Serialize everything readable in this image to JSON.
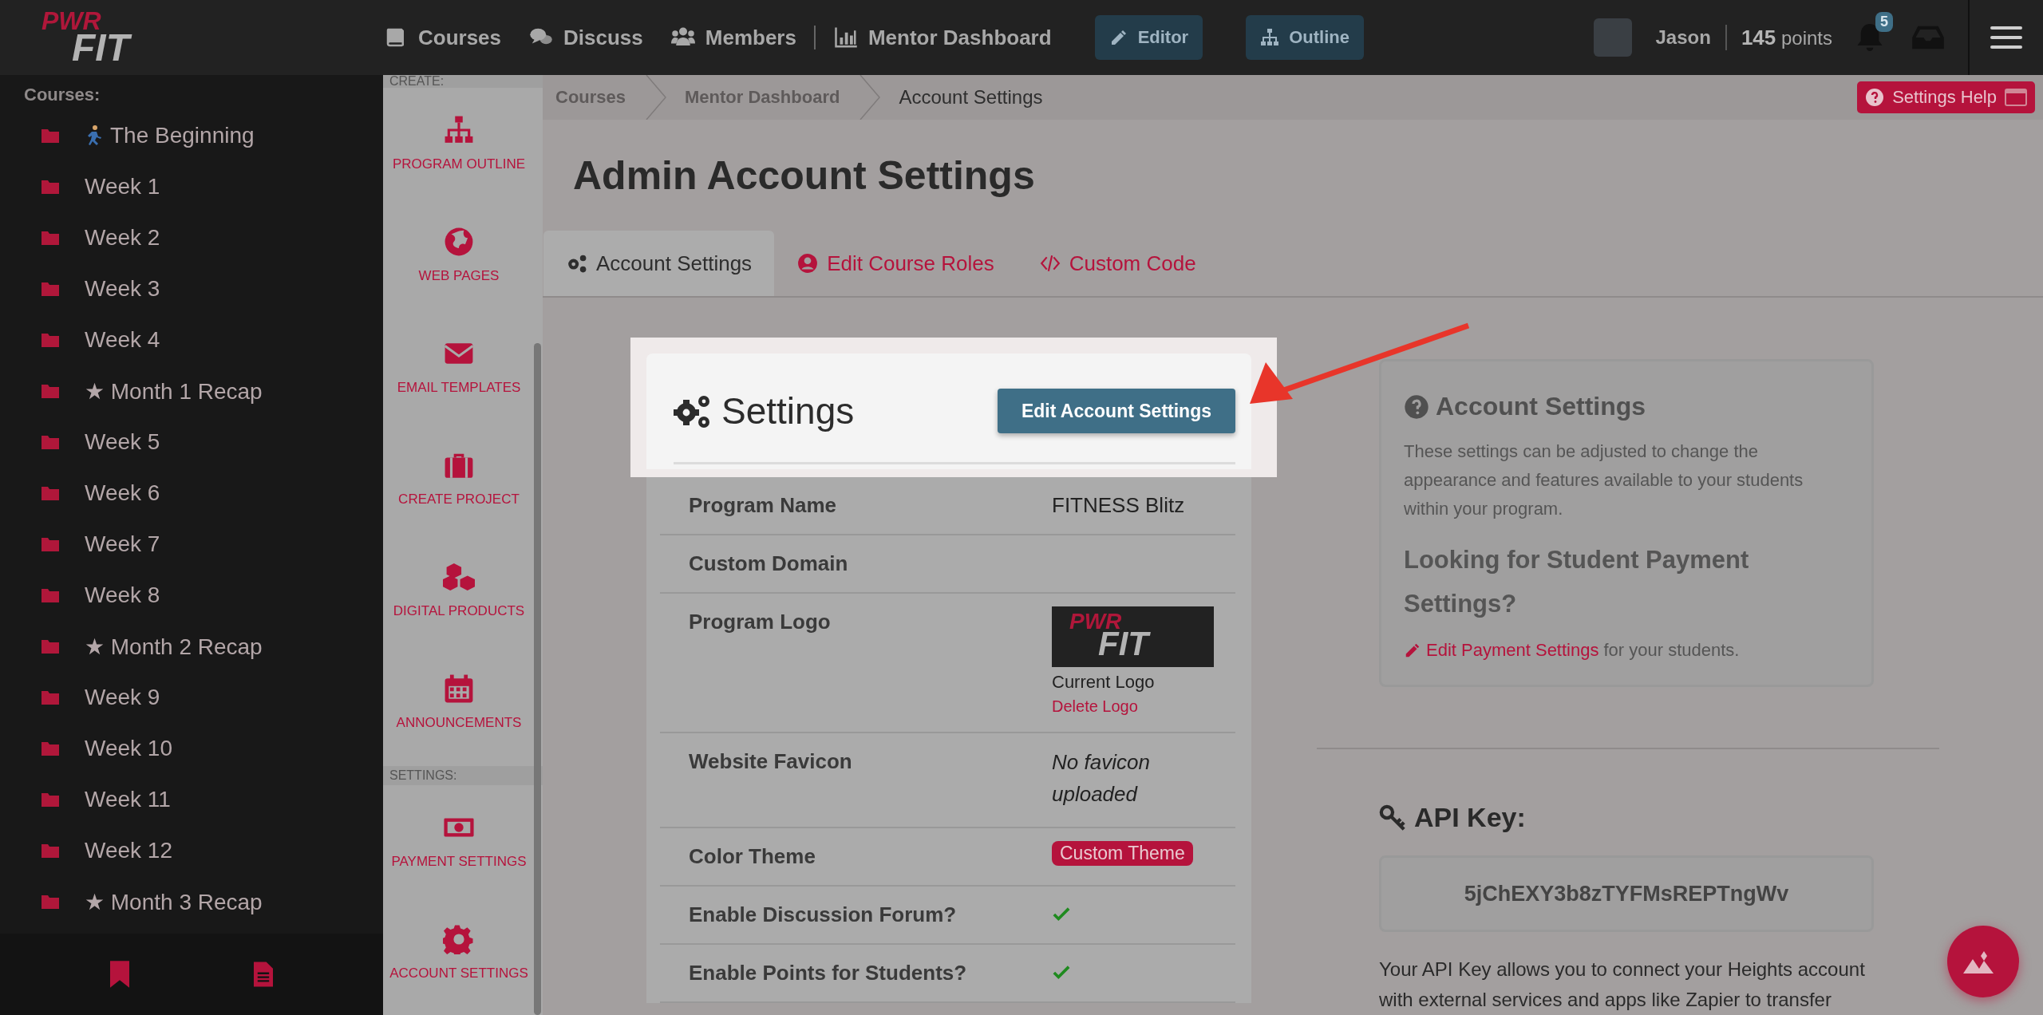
{
  "topbar": {
    "logo": {
      "top": "PWR",
      "bottom": "FIT"
    },
    "nav": [
      {
        "label": "Courses"
      },
      {
        "label": "Discuss"
      },
      {
        "label": "Members"
      },
      {
        "label": "Mentor Dashboard"
      }
    ],
    "mode_buttons": [
      {
        "label": "Editor"
      },
      {
        "label": "Outline"
      }
    ],
    "user": {
      "name": "Jason",
      "points": "145",
      "points_label": "points"
    },
    "notifications": {
      "count": "5"
    }
  },
  "sidebar": {
    "heading": "Courses:",
    "items": [
      {
        "label": "The Beginning",
        "kind": "runner"
      },
      {
        "label": "Week 1",
        "kind": "plain"
      },
      {
        "label": "Week 2",
        "kind": "plain"
      },
      {
        "label": "Week 3",
        "kind": "plain"
      },
      {
        "label": "Week 4",
        "kind": "plain"
      },
      {
        "label": "★ Month 1 Recap",
        "kind": "plain"
      },
      {
        "label": "Week 5",
        "kind": "plain"
      },
      {
        "label": "Week 6",
        "kind": "plain"
      },
      {
        "label": "Week 7",
        "kind": "plain"
      },
      {
        "label": "Week 8",
        "kind": "plain"
      },
      {
        "label": "★ Month 2 Recap",
        "kind": "plain"
      },
      {
        "label": "Week 9",
        "kind": "plain"
      },
      {
        "label": "Week 10",
        "kind": "plain"
      },
      {
        "label": "Week 11",
        "kind": "plain"
      },
      {
        "label": "Week 12",
        "kind": "plain"
      },
      {
        "label": "★ Month 3 Recap",
        "kind": "plain"
      }
    ]
  },
  "tools": [
    {
      "heading": "CREATE:",
      "items": [
        "PROGRAM OUTLINE",
        "WEB PAGES",
        "EMAIL TEMPLATES",
        "CREATE PROJECT",
        "DIGITAL PRODUCTS",
        "ANNOUNCEMENTS"
      ]
    },
    {
      "heading": "SETTINGS:",
      "items": [
        "PAYMENT SETTINGS",
        "ACCOUNT SETTINGS"
      ]
    }
  ],
  "breadcrumb": [
    {
      "label": "Courses",
      "current": false
    },
    {
      "label": "Mentor Dashboard",
      "current": false
    },
    {
      "label": "Account Settings",
      "current": true
    }
  ],
  "help_button": "Settings Help",
  "page_title": "Admin Account Settings",
  "tabs": [
    {
      "label": "Account Settings",
      "selected": true
    },
    {
      "label": "Edit Course Roles",
      "selected": false
    },
    {
      "label": "Custom Code",
      "selected": false
    }
  ],
  "settings_card": {
    "title": "Settings",
    "edit_button": "Edit Account Settings",
    "rows": [
      {
        "label": "Program Name",
        "kind": "text",
        "value": "FITNESS Blitz"
      },
      {
        "label": "Custom Domain",
        "kind": "empty"
      },
      {
        "label": "Program Logo",
        "kind": "logo",
        "logo": {
          "top": "PWR",
          "bottom": "FIT"
        },
        "caption": "Current Logo",
        "link": "Delete Logo"
      },
      {
        "label": "Website Favicon",
        "kind": "note",
        "value": "No favicon uploaded"
      },
      {
        "label": "Color Theme",
        "kind": "pill",
        "value": "Custom Theme"
      },
      {
        "label": "Enable Discussion Forum?",
        "kind": "check",
        "checked": true
      },
      {
        "label": "Enable Points for Students?",
        "kind": "check",
        "checked": true
      }
    ]
  },
  "info_panel": {
    "title": "Account Settings",
    "text": "These settings can be adjusted to change the appearance and features available to your students within your program.",
    "subtitle": "Looking for Student Payment Settings?",
    "link": "Edit Payment Settings",
    "link_suffix": "for your students."
  },
  "api_key": {
    "title": "API Key:",
    "value": "5jChEXY3b8zTYFMsREPTngWv",
    "description": "Your API Key allows you to connect your Heights account with external services and apps like Zapier to transfer"
  }
}
